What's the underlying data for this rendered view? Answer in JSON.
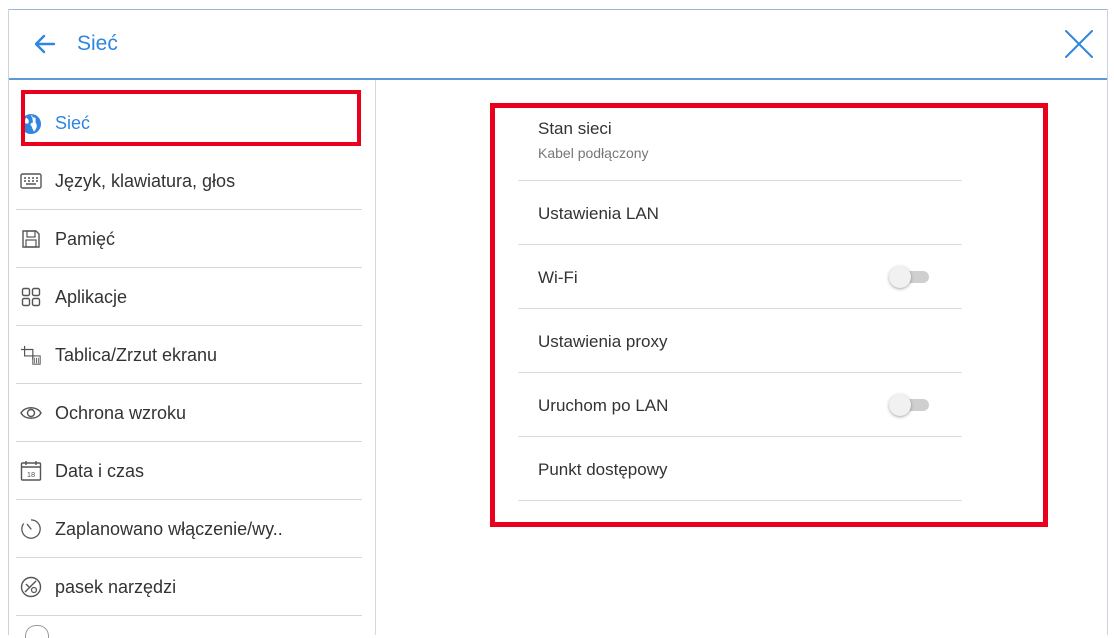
{
  "header": {
    "title": "Sieć",
    "back_icon": "arrow-left-icon",
    "close_icon": "close-icon",
    "accent": "#2e86de"
  },
  "sidebar": {
    "items": [
      {
        "label": "Sieć",
        "icon": "globe-icon",
        "active": true
      },
      {
        "label": "Język, klawiatura, głos",
        "icon": "keyboard-icon"
      },
      {
        "label": "Pamięć",
        "icon": "floppy-disk-icon"
      },
      {
        "label": "Aplikacje",
        "icon": "apps-grid-icon"
      },
      {
        "label": "Tablica/Zrzut ekranu",
        "icon": "crop-board-icon"
      },
      {
        "label": "Ochrona wzroku",
        "icon": "eye-icon"
      },
      {
        "label": "Data i czas",
        "icon": "calendar-icon",
        "icon_text": "18"
      },
      {
        "label": "Zaplanowano włączenie/wy..",
        "icon": "timer-icon"
      },
      {
        "label": "pasek narzędzi",
        "icon": "toolbar-icon"
      }
    ]
  },
  "settings": {
    "items": [
      {
        "title": "Stan sieci",
        "subtitle": "Kabel podłączony"
      },
      {
        "title": "Ustawienia LAN"
      },
      {
        "title": "Wi-Fi",
        "toggle": false
      },
      {
        "title": "Ustawienia proxy"
      },
      {
        "title": "Uruchom po LAN",
        "toggle": false
      },
      {
        "title": "Punkt dostępowy"
      }
    ]
  },
  "colors": {
    "highlight_border": "#e8001c",
    "header_border": "#5b9ad6"
  }
}
